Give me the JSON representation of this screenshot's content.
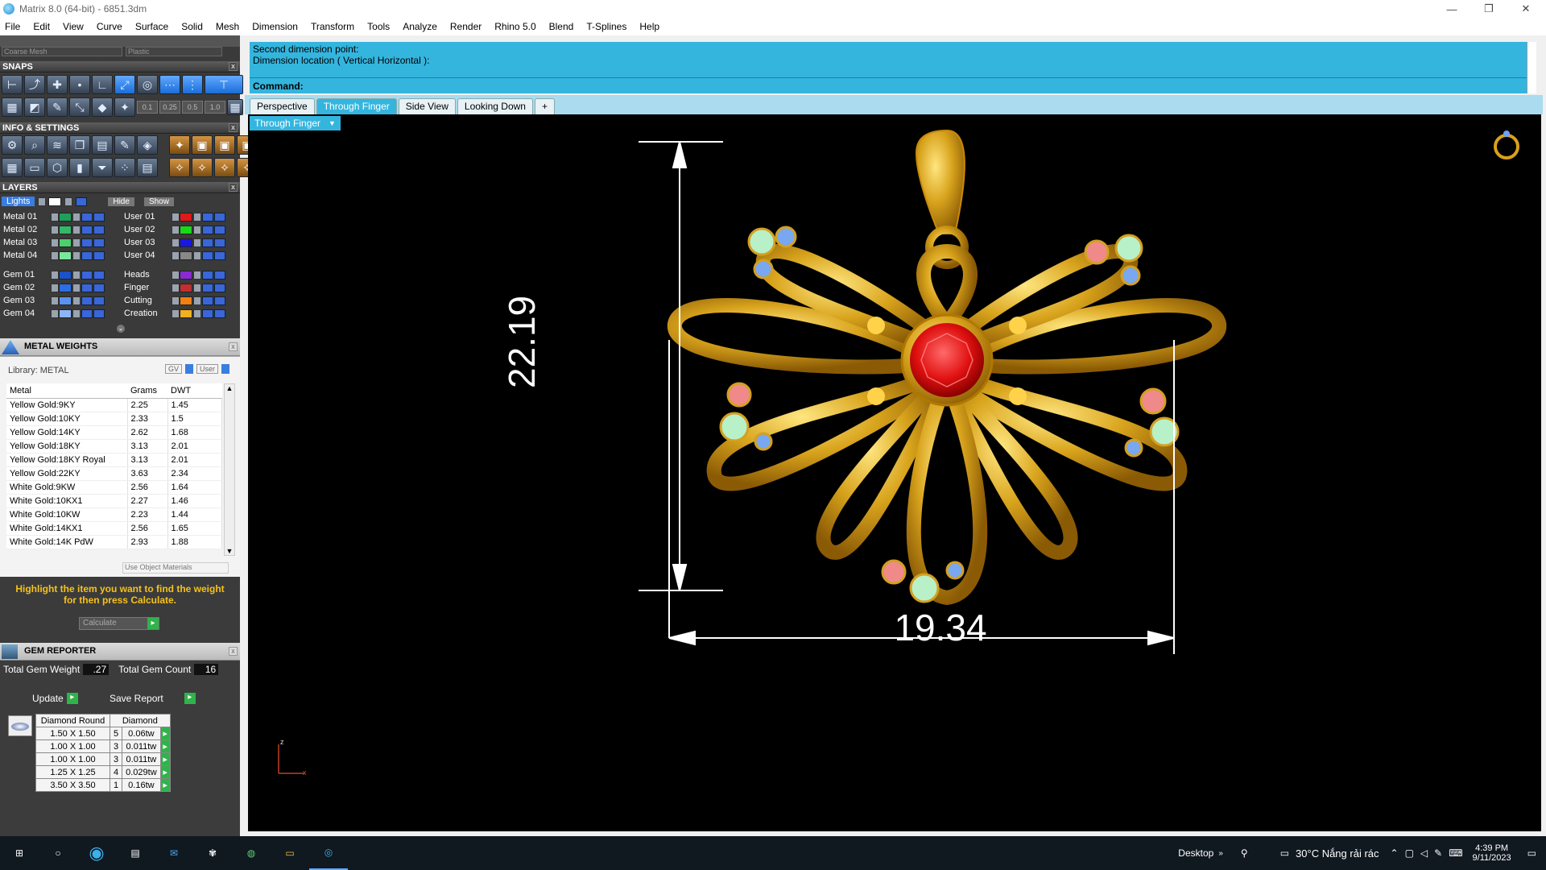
{
  "window": {
    "title": "Matrix 8.0 (64-bit) - 6851.3dm",
    "controls": [
      "—",
      "❐",
      "✕"
    ]
  },
  "menu": [
    "File",
    "Edit",
    "View",
    "Curve",
    "Surface",
    "Solid",
    "Mesh",
    "Dimension",
    "Transform",
    "Tools",
    "Analyze",
    "Render",
    "Rhino 5.0",
    "Blend",
    "T-Splines",
    "Help"
  ],
  "top_dropdowns": {
    "left": "Coarse Mesh",
    "right": "Plastic"
  },
  "snaps": {
    "title": "SNAPS",
    "values": [
      "0.1",
      "0.25",
      "0.5",
      "1.0"
    ]
  },
  "info": {
    "title": "INFO & SETTINGS"
  },
  "layers": {
    "title": "LAYERS",
    "lights": "Lights",
    "hide": "Hide",
    "show": "Show",
    "left": [
      {
        "name": "Metal 01",
        "color": "#1fa05a"
      },
      {
        "name": "Metal 02",
        "color": "#33b86a"
      },
      {
        "name": "Metal 03",
        "color": "#4bd06e"
      },
      {
        "name": "Metal 04",
        "color": "#7ae89a"
      },
      {
        "name": "Gem 01",
        "color": "#1a52c8"
      },
      {
        "name": "Gem 02",
        "color": "#2a6ee8"
      },
      {
        "name": "Gem 03",
        "color": "#5a92f0"
      },
      {
        "name": "Gem 04",
        "color": "#8ab6f8"
      }
    ],
    "right": [
      {
        "name": "User 01",
        "color": "#e01818"
      },
      {
        "name": "User 02",
        "color": "#18d818"
      },
      {
        "name": "User 03",
        "color": "#1818e0"
      },
      {
        "name": "User 04",
        "color": "#888888"
      },
      {
        "name": "Heads",
        "color": "#8a2ad0"
      },
      {
        "name": "Finger",
        "color": "#c03030"
      },
      {
        "name": "Cutting",
        "color": "#f08010"
      },
      {
        "name": "Creation",
        "color": "#f0b020"
      }
    ]
  },
  "metal_weights": {
    "title": "METAL WEIGHTS",
    "library": "Library: METAL",
    "tog_gv": "GV",
    "tog_user": "User",
    "headers": [
      "Metal",
      "Grams",
      "DWT"
    ],
    "rows": [
      [
        "Yellow Gold:9KY",
        "2.25",
        "1.45"
      ],
      [
        "Yellow Gold:10KY",
        "2.33",
        "1.5"
      ],
      [
        "Yellow Gold:14KY",
        "2.62",
        "1.68"
      ],
      [
        "Yellow Gold:18KY",
        "3.13",
        "2.01"
      ],
      [
        "Yellow Gold:18KY Royal",
        "3.13",
        "2.01"
      ],
      [
        "Yellow Gold:22KY",
        "3.63",
        "2.34"
      ],
      [
        "White Gold:9KW",
        "2.56",
        "1.64"
      ],
      [
        "White Gold:10KX1",
        "2.27",
        "1.46"
      ],
      [
        "White Gold:10KW",
        "2.23",
        "1.44"
      ],
      [
        "White Gold:14KX1",
        "2.56",
        "1.65"
      ],
      [
        "White Gold:14K PdW",
        "2.93",
        "1.88"
      ]
    ],
    "use_obj": "Use Object Materials",
    "hint": "Highlight the item you want to find the weight for then press Calculate.",
    "calculate": "Calculate"
  },
  "gem_reporter": {
    "title": "GEM REPORTER",
    "total_weight_label": "Total Gem Weight",
    "total_weight": ".27",
    "total_count_label": "Total Gem Count",
    "total_count": "16",
    "update": "Update",
    "save": "Save Report",
    "headers": [
      "Diamond Round",
      "Diamond"
    ],
    "rows": [
      [
        "1.50 X 1.50",
        "5",
        "0.06tw"
      ],
      [
        "1.00 X 1.00",
        "3",
        "0.011tw"
      ],
      [
        "1.00 X 1.00",
        "3",
        "0.011tw"
      ],
      [
        "1.25 X 1.25",
        "4",
        "0.029tw"
      ],
      [
        "3.50 X 3.50",
        "1",
        "0.16tw"
      ]
    ]
  },
  "command": {
    "line1": "Second dimension point:",
    "line2": "Dimension location ( Vertical  Horizontal ):",
    "prompt": "Command:"
  },
  "view_tabs": [
    "Perspective",
    "Through Finger",
    "Side View",
    "Looking Down",
    "+"
  ],
  "active_view": "Through Finger",
  "dimensions": {
    "vertical": "22.19",
    "horizontal": "19.34"
  },
  "axis": {
    "z": "z",
    "x": "x"
  },
  "taskbar": {
    "desktop": "Desktop",
    "weather": "30°C  Nắng rải rác",
    "time": "4:39 PM",
    "date": "9/11/2023"
  }
}
